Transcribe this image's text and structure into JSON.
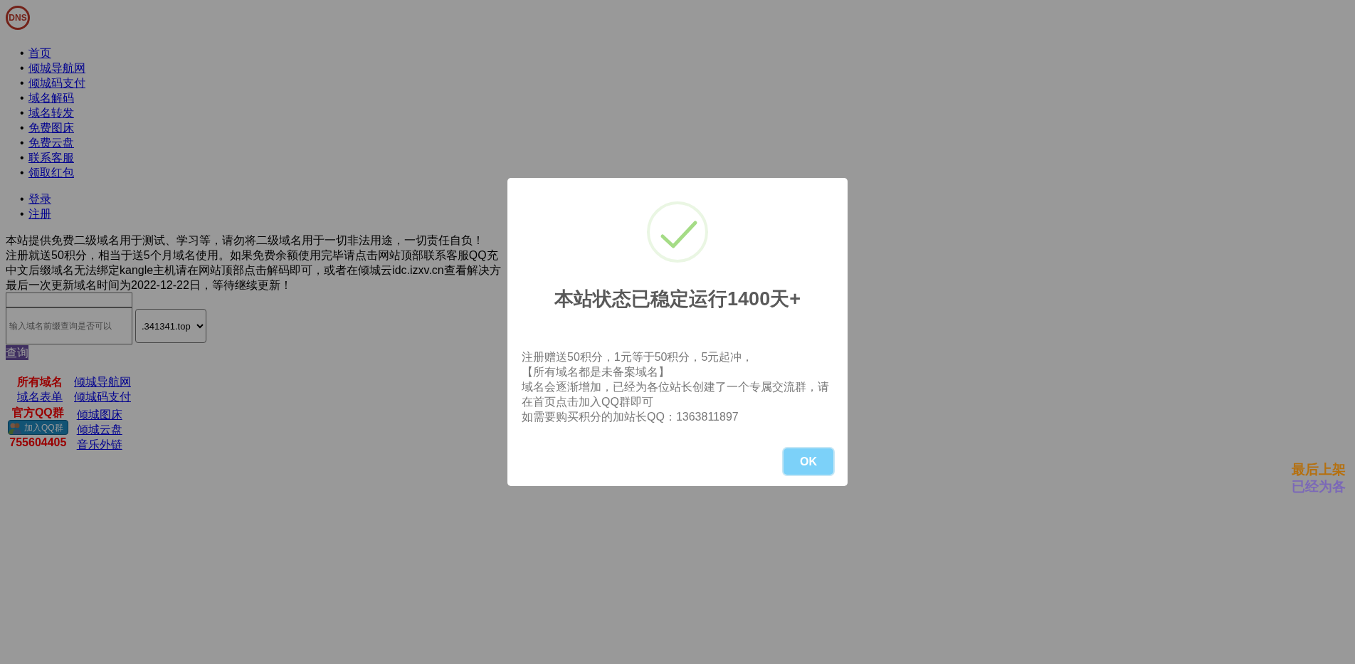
{
  "logo": {
    "text": "DNS"
  },
  "nav": [
    {
      "label": "首页"
    },
    {
      "label": "倾城导航网"
    },
    {
      "label": "倾城码支付"
    },
    {
      "label": "域名解码"
    },
    {
      "label": "域名转发"
    },
    {
      "label": "免费图床"
    },
    {
      "label": "免费云盘"
    },
    {
      "label": "联系客服"
    },
    {
      "label": "领取红包"
    }
  ],
  "account_nav": [
    {
      "label": "登录"
    },
    {
      "label": "注册"
    }
  ],
  "notice_lines": [
    "本站提供免费二级域名用于测试、学习等，请勿将二级域名用于一切非法用途，一切责任自负！",
    "注册就送50积分，相当于送5个月域名使用。如果免费余额使用完毕请点击网站顶部联系客服QQ充",
    "中文后缀域名无法绑定kangle主机请在网站顶部点击解码即可，或者在倾城云idc.izxv.cn查看解决方",
    "最后一次更新域名时间为2022-12-22日，等待继续更新！"
  ],
  "search": {
    "placeholder": "输入域名前缀查询是否可以",
    "suffix": ".341341.top",
    "button": "查询"
  },
  "links_top": {
    "left": [
      {
        "kind": "heading",
        "label": "所有域名"
      },
      {
        "kind": "link",
        "label": "域名表单"
      }
    ],
    "right": [
      {
        "label": "倾城导航网"
      },
      {
        "label": "倾城码支付"
      }
    ]
  },
  "links_bottom": {
    "left": [
      {
        "kind": "heading",
        "label": "官方QQ群"
      },
      {
        "kind": "qq_button",
        "label": "加入QQ群"
      },
      {
        "kind": "number",
        "label": "755604405"
      }
    ],
    "right": [
      {
        "label": "倾城图床"
      },
      {
        "label": "倾城云盘"
      },
      {
        "label": "音乐外链"
      }
    ]
  },
  "list_marker": "•",
  "marquee": [
    {
      "text": "最后上架",
      "color": "#b5700f"
    },
    {
      "text": "已经为各",
      "color": "#7b68b8"
    }
  ],
  "dialog": {
    "title": "本站状态已稳定运行1400天+",
    "lines": [
      "注册赠送50积分，1元等于50积分，5元起冲，",
      "【所有域名都是未备案域名】",
      "域名会逐渐增加，已经为各位站长创建了一个专属交流群，请在首页点击加入QQ群即可",
      "如需要购买积分的加站长QQ：1363811897"
    ],
    "ok": "OK"
  }
}
